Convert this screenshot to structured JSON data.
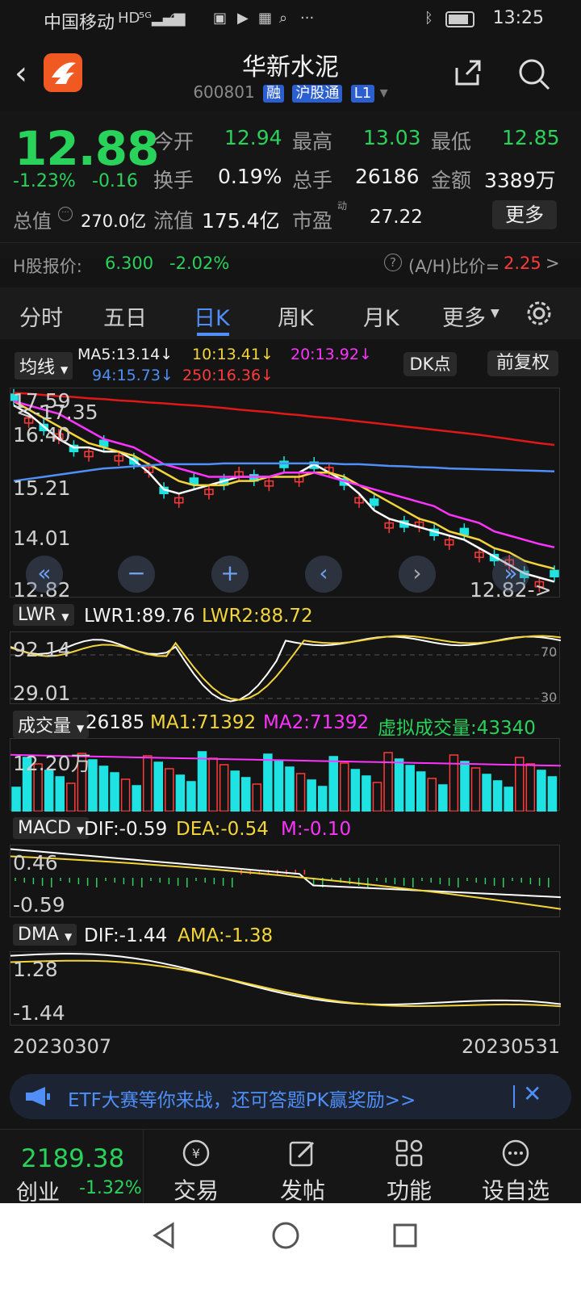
{
  "status_bar": {
    "carrier": "中国移动",
    "time": "13:25",
    "icons": [
      "hd-icon",
      "5g-signal-icon",
      "wifi-icon",
      "app-icon-1",
      "app-icon-2",
      "app-icon-3",
      "app-icon-4",
      "more-icon",
      "bluetooth-icon",
      "battery-icon"
    ]
  },
  "header": {
    "title": "华新水泥",
    "code": "600801",
    "tag1": "融",
    "tag2": "沪股通",
    "tag3": "L1"
  },
  "quote": {
    "price": "12.88",
    "change_pct": "-1.23%",
    "change": "-0.16",
    "open_label": "今开",
    "open": "12.94",
    "high_label": "最高",
    "high": "13.03",
    "low_label": "最低",
    "low": "12.85",
    "turnover_label": "换手",
    "turnover": "0.19%",
    "volume_label": "总手",
    "volume": "26186",
    "amount_label": "金额",
    "amount": "3389万",
    "total_value_label": "总值",
    "total_value": "270.0亿",
    "float_value_label": "流值",
    "float_value": "175.4亿",
    "pe_label": "市盈",
    "pe_sup": "动",
    "pe": "27.22",
    "more_button": "更多",
    "h_label": "H股报价:",
    "h_price": "6.300",
    "h_change": "-2.02%",
    "ah_label": "(A/H)比价=",
    "ah_value": "2.25",
    "ah_arrow": ">"
  },
  "tabs": {
    "items": [
      "分时",
      "五日",
      "日K",
      "周K",
      "月K",
      "更多"
    ],
    "active": "日K"
  },
  "kline": {
    "ma_button": "均线",
    "ma5": "MA5:13.14↓",
    "ma10": "10:13.41↓",
    "ma20": "20:13.92↓",
    "ma94": "94:15.73↓",
    "ma250": "250:16.36↓",
    "dk_button": "DK点",
    "adjust_button": "前复权",
    "y_labels": [
      "17.59",
      "16.40",
      "15.21",
      "14.01",
      "12.82"
    ],
    "high_marker": "<-17.35",
    "low_marker": "12.82->",
    "colors": {
      "up": "#ff3a3a",
      "down": "#1fe3e3",
      "ma5": "#ffffff",
      "ma10": "#f3d53b",
      "ma20": "#ff33ff",
      "ma94": "#4f8ff7",
      "ma250": "#e01818"
    }
  },
  "chart_data": [
    {
      "type": "candlestick",
      "title": "",
      "ylim": [
        12.82,
        17.59
      ],
      "x": [
        "20230307",
        "20230531"
      ],
      "series": [
        {
          "name": "MA5",
          "values": [
            17.3,
            17.1,
            16.8,
            16.5,
            16.3,
            16.3,
            16.2,
            16.2,
            16.0,
            15.7,
            15.3,
            15.2,
            15.3,
            15.4,
            15.5,
            15.6,
            15.6,
            15.6,
            15.7,
            15.7,
            15.9,
            15.7,
            15.5,
            15.2,
            14.8,
            14.6,
            14.5,
            14.4,
            14.3,
            14.2,
            14.1,
            13.9,
            13.7,
            13.5,
            13.3,
            13.2,
            13.1
          ]
        },
        {
          "name": "MA10",
          "values": [
            17.4,
            17.2,
            17.0,
            16.8,
            16.6,
            16.4,
            16.3,
            16.2,
            16.1,
            15.9,
            15.7,
            15.5,
            15.4,
            15.4,
            15.4,
            15.5,
            15.5,
            15.6,
            15.6,
            15.6,
            15.7,
            15.7,
            15.6,
            15.4,
            15.2,
            15.0,
            14.8,
            14.6,
            14.5,
            14.3,
            14.2,
            14.1,
            13.9,
            13.8,
            13.6,
            13.5,
            13.41
          ]
        },
        {
          "name": "MA20",
          "values": [
            17.4,
            17.3,
            17.2,
            17.1,
            16.9,
            16.7,
            16.5,
            16.4,
            16.3,
            16.1,
            15.9,
            15.8,
            15.7,
            15.6,
            15.6,
            15.6,
            15.6,
            15.6,
            15.7,
            15.7,
            15.7,
            15.6,
            15.5,
            15.4,
            15.3,
            15.2,
            15.1,
            15.0,
            14.9,
            14.7,
            14.6,
            14.5,
            14.3,
            14.2,
            14.1,
            14.0,
            13.92
          ]
        },
        {
          "name": "MA94",
          "values": [
            15.5,
            15.55,
            15.6,
            15.65,
            15.7,
            15.75,
            15.8,
            15.82,
            15.85,
            15.87,
            15.9,
            15.9,
            15.9,
            15.9,
            15.92,
            15.92,
            15.92,
            15.92,
            15.92,
            15.92,
            15.92,
            15.92,
            15.9,
            15.9,
            15.88,
            15.86,
            15.85,
            15.83,
            15.82,
            15.8,
            15.79,
            15.78,
            15.77,
            15.76,
            15.75,
            15.74,
            15.73
          ]
        },
        {
          "name": "MA250",
          "values": [
            17.6,
            17.58,
            17.55,
            17.52,
            17.5,
            17.47,
            17.45,
            17.42,
            17.4,
            17.37,
            17.35,
            17.32,
            17.3,
            17.27,
            17.24,
            17.2,
            17.17,
            17.14,
            17.1,
            17.07,
            17.03,
            17.0,
            16.96,
            16.92,
            16.88,
            16.84,
            16.8,
            16.76,
            16.72,
            16.68,
            16.64,
            16.6,
            16.55,
            16.5,
            16.45,
            16.4,
            16.36
          ]
        }
      ]
    }
  ],
  "lwr": {
    "button": "LWR",
    "lwr1": "LWR1:89.76",
    "lwr2": "LWR2:88.72",
    "y_top": "92.14",
    "y_bottom": "29.01",
    "ref_top": "70",
    "ref_bottom": "30"
  },
  "volume": {
    "button": "成交量",
    "value": "26185",
    "ma1": "MA1:71392",
    "ma2": "MA2:71392",
    "virtual": "虚拟成交量:43340",
    "y_top": "12.20万"
  },
  "macd": {
    "button": "MACD",
    "dif": "DIF:-0.59",
    "dea": "DEA:-0.54",
    "m": "M:-0.10",
    "y_top": "0.46",
    "y_bottom": "-0.59"
  },
  "dma": {
    "button": "DMA",
    "dif": "DIF:-1.44",
    "ama": "AMA:-1.38",
    "y_top": "1.28",
    "y_bottom": "-1.44"
  },
  "dates": {
    "start": "20230307",
    "end": "20230531"
  },
  "banner": {
    "text": "ETF大赛等你来战，还可答题PK赢奖励>>",
    "close": "✕"
  },
  "bottom": {
    "index_value": "2189.38",
    "index_name": "创业",
    "index_change": "-1.32%",
    "items": [
      "交易",
      "发帖",
      "功能",
      "设自选"
    ]
  }
}
